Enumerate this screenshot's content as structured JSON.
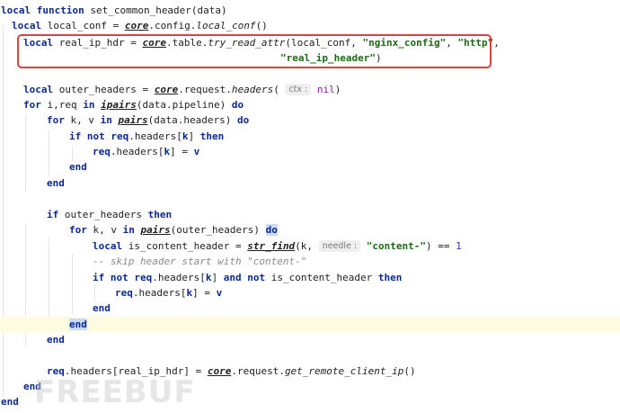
{
  "editor": {
    "lines": {
      "l1": {
        "t1": "local function ",
        "t2": "set_common_header(data)"
      },
      "l2": {
        "t1": "local ",
        "t2": "local_conf = ",
        "t3": "core",
        "t4": ".config.",
        "t5": "local_conf",
        "t6": "()"
      },
      "l3": {
        "t1": "local ",
        "t2": "real_ip_hdr = ",
        "t3": "core",
        "t4": ".table.",
        "t5": "try_read_attr",
        "t6": "(local_conf, ",
        "t7": "\"nginx_config\"",
        "t8": ", ",
        "t9": "\"http\"",
        "t10": ","
      },
      "l4": {
        "t1": "\"real_ip_header\"",
        "t2": ")"
      },
      "l6": {
        "t1": "local ",
        "t2": "outer_headers = ",
        "t3": "core",
        "t4": ".request.",
        "t5": "headers",
        "t6": "(",
        "hint": "ctx :",
        "t7": "nil",
        "t8": ")"
      },
      "l7": {
        "t1": "for ",
        "t2": "i,req ",
        "t3": "in ",
        "t4": "ipairs",
        "t5": "(data.pipeline) ",
        "t6": "do"
      },
      "l8": {
        "t1": "for ",
        "t2": "k, v ",
        "t3": "in ",
        "t4": "pairs",
        "t5": "(data.headers) ",
        "t6": "do"
      },
      "l9": {
        "t1": "if not ",
        "t2": "req",
        "t3": ".headers[",
        "t4": "k",
        "t5": "] ",
        "t6": "then"
      },
      "l10": {
        "t1": "req",
        "t2": ".headers[",
        "t3": "k",
        "t4": "] = ",
        "t5": "v"
      },
      "l11": {
        "t1": "end"
      },
      "l12": {
        "t1": "end"
      },
      "l14": {
        "t1": "if ",
        "t2": "outer_headers ",
        "t3": "then"
      },
      "l15": {
        "t1": "for ",
        "t2": "k, v ",
        "t3": "in ",
        "t4": "pairs",
        "t5": "(outer_headers) ",
        "t6": "do"
      },
      "l16": {
        "t1": "local ",
        "t2": "is_content_header = ",
        "t3": "str_find",
        "t4": "(k, ",
        "hint": "needle :",
        "t5": "\"content-\"",
        "t6": ") == ",
        "t7": "1"
      },
      "l17": {
        "t1": "-- skip header start with \"content-\""
      },
      "l18": {
        "t1": "if not ",
        "t2": "req",
        "t3": ".headers[",
        "t4": "k",
        "t5": "] ",
        "t6": "and not ",
        "t7": "is_content_header ",
        "t8": "then"
      },
      "l19": {
        "t1": "req",
        "t2": ".headers[",
        "t3": "k",
        "t4": "] = ",
        "t5": "v"
      },
      "l20": {
        "t1": "end"
      },
      "l21": {
        "t1": "end"
      },
      "l22": {
        "t1": "end"
      },
      "l24": {
        "t1": "req",
        "t2": ".headers[real_ip_hdr] = ",
        "t3": "core",
        "t4": ".request.",
        "t5": "get_remote_client_ip",
        "t6": "()"
      },
      "l25": {
        "t1": "end"
      },
      "l26": {
        "t1": "end"
      }
    }
  },
  "watermark": {
    "text": "FREEBUF"
  },
  "colors": {
    "keyword": "#0b2a8f",
    "string": "#1b6b12",
    "number": "#1c3fd6",
    "comment": "#8a8a8a",
    "nil": "#8b1aa8",
    "highlight_box": "#d6453b",
    "current_line": "#fdfce0",
    "brace_match": "#c9dbf5"
  }
}
